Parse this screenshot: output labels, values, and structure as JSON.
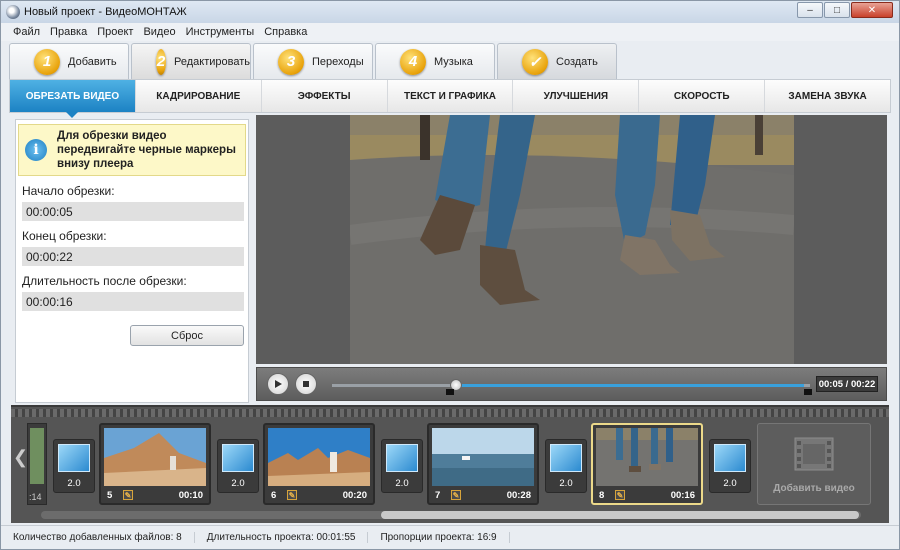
{
  "window": {
    "title": "Новый проект - ВидеоМОНТАЖ",
    "minimize": "–",
    "maximize": "□",
    "close": "✕"
  },
  "menu": [
    "Файл",
    "Правка",
    "Проект",
    "Видео",
    "Инструменты",
    "Справка"
  ],
  "steps": [
    {
      "num": "1",
      "label": "Добавить"
    },
    {
      "num": "2",
      "label": "Редактировать"
    },
    {
      "num": "3",
      "label": "Переходы"
    },
    {
      "num": "4",
      "label": "Музыка"
    },
    {
      "num": "✓",
      "label": "Создать"
    }
  ],
  "tabs": [
    "ОБРЕЗАТЬ ВИДЕО",
    "КАДРИРОВАНИЕ",
    "ЭФФЕКТЫ",
    "ТЕКСТ И ГРАФИКА",
    "УЛУЧШЕНИЯ",
    "СКОРОСТЬ",
    "ЗАМЕНА ЗВУКА"
  ],
  "trim": {
    "hint": "Для обрезки видео передвигайте черные маркеры внизу плеера",
    "start_label": "Начало обрезки:",
    "start_value": "00:00:05",
    "end_label": "Конец обрезки:",
    "end_value": "00:00:22",
    "duration_label": "Длительность после обрезки:",
    "duration_value": "00:00:16",
    "reset_label": "Сброс"
  },
  "player": {
    "time": "00:05 / 00:22",
    "progress_fraction": 0.26
  },
  "timeline": {
    "left_edge_time": ":14",
    "clips": [
      {
        "num": "5",
        "duration": "00:10"
      },
      {
        "num": "6",
        "duration": "00:20"
      },
      {
        "num": "7",
        "duration": "00:28"
      },
      {
        "num": "8",
        "duration": "00:16"
      }
    ],
    "transitions": [
      "2.0",
      "2.0",
      "2.0",
      "2.0",
      "2.0"
    ],
    "add_video_label": "Добавить видео"
  },
  "status": {
    "files": "Количество добавленных файлов: 8",
    "duration": "Длительность проекта: 00:01:55",
    "ratio": "Пропорции проекта: 16:9"
  },
  "colors": {
    "accent": "#1c82c4",
    "selected_clip": "#ecd98a",
    "step_badge": "#e8a20a"
  }
}
